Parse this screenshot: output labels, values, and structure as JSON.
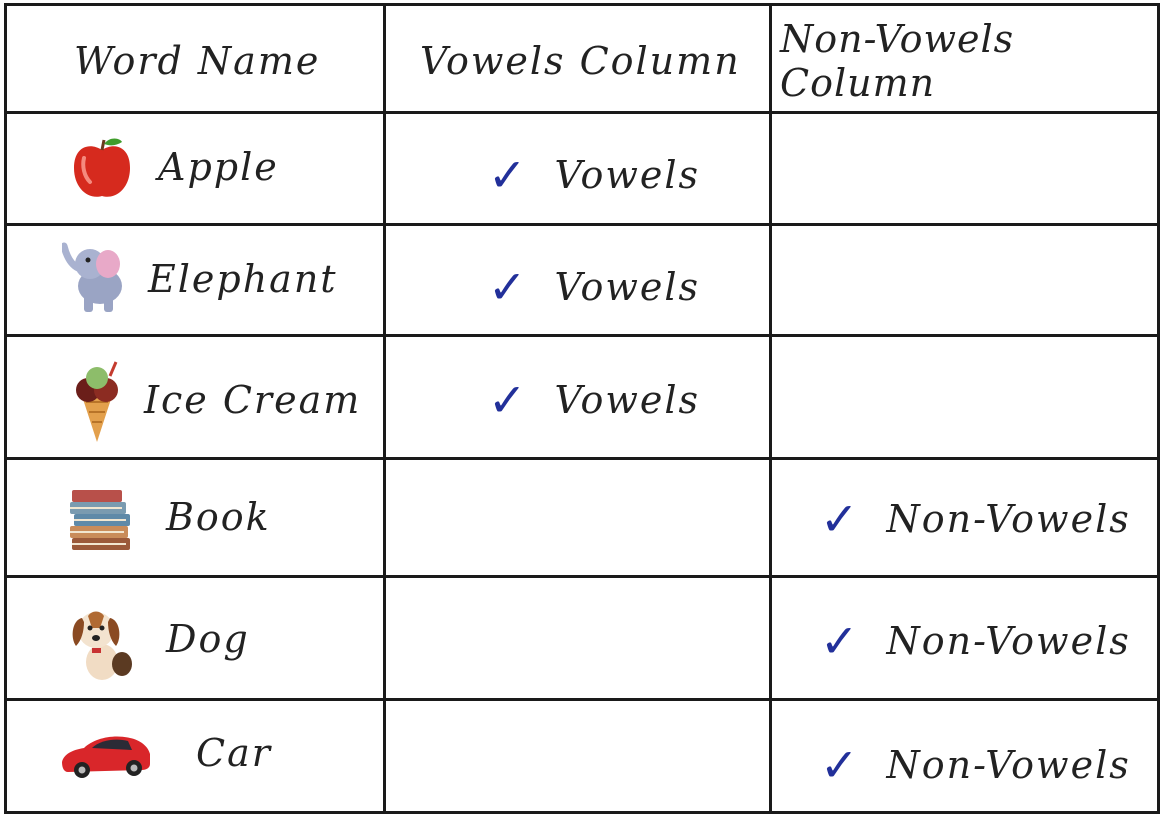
{
  "table": {
    "headers": {
      "word": "Word Name",
      "vowels": "Vowels Column",
      "non_vowels": "Non-Vowels Column"
    },
    "rows": [
      {
        "word": "Apple",
        "icon": "apple-icon",
        "vowel_mark": "Vowels",
        "nonvowel_mark": ""
      },
      {
        "word": "Elephant",
        "icon": "elephant-icon",
        "vowel_mark": "Vowels",
        "nonvowel_mark": ""
      },
      {
        "word": "Ice Cream",
        "icon": "ice-cream-icon",
        "vowel_mark": "Vowels",
        "nonvowel_mark": ""
      },
      {
        "word": "Book",
        "icon": "books-icon",
        "vowel_mark": "",
        "nonvowel_mark": "Non-Vowels"
      },
      {
        "word": "Dog",
        "icon": "dog-icon",
        "vowel_mark": "",
        "nonvowel_mark": "Non-Vowels"
      },
      {
        "word": "Car",
        "icon": "car-icon",
        "vowel_mark": "",
        "nonvowel_mark": "Non-Vowels"
      }
    ],
    "check_color": "#22309a"
  }
}
